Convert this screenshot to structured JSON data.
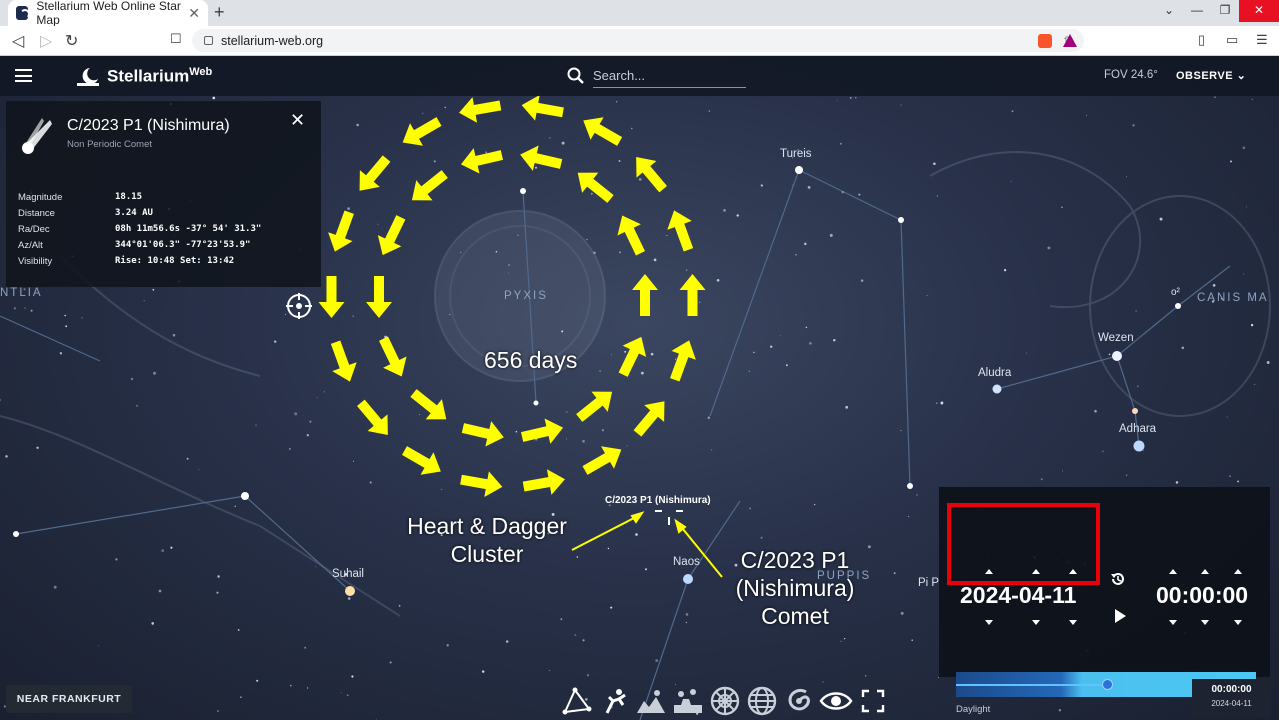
{
  "browser": {
    "tab_title": "Stellarium Web Online Star Map",
    "url": "stellarium-web.org",
    "new_tab": "+",
    "close_tab": "✕",
    "window_controls": [
      "⌄",
      "—",
      "❐",
      "✕"
    ]
  },
  "app": {
    "logo": "Stellarium",
    "logo_sup": "Web",
    "search_placeholder": "Search...",
    "fov": "FOV 24.6°",
    "observe": "OBSERVE ⌄"
  },
  "info_panel": {
    "title": "C/2023 P1 (Nishimura)",
    "subtitle": "Non Periodic Comet",
    "close": "✕",
    "rows": [
      {
        "label": "Magnitude",
        "value": "18.15"
      },
      {
        "label": "Distance",
        "value": "3.24 AU"
      },
      {
        "label": "Ra/Dec",
        "value": "08h 11m56.6s  -37° 54' 31.3\""
      },
      {
        "label": "Az/Alt",
        "value": "344°01'06.3\"  -77°23'53.9\""
      },
      {
        "label": "Visibility",
        "value": "Rise: 10:48   Set: 13:42"
      }
    ]
  },
  "sky_labels": {
    "stars": [
      "Tureis",
      "Wezen",
      "Aludra",
      "Adhara",
      "Suhail",
      "Naos",
      "Pi P",
      "o²"
    ],
    "constellations": [
      "PYXIS",
      "PUPPIS",
      "CANIS MA",
      "NTLIA"
    ],
    "comet_label": "C/2023 P1 (Nishimura)"
  },
  "annotations": {
    "days": "656 days",
    "heart_dagger": [
      "Heart & Dagger",
      "Cluster"
    ],
    "comet": [
      "C/2023 P1",
      "(Nishimura)",
      "Comet"
    ]
  },
  "time_panel": {
    "date": "2024-04-11",
    "time": "00:00:00",
    "daylight": "Daylight"
  },
  "location": "NEAR FRANKFURT",
  "mini_clock": {
    "time": "00:00:00",
    "date": "2024-04-11"
  },
  "toolbar_icons": [
    "constellation-lines-icon",
    "constellation-art-icon",
    "landscape-icon",
    "atmosphere-icon",
    "azimuthal-grid-icon",
    "equatorial-grid-icon",
    "deep-sky-icon",
    "night-mode-icon",
    "fullscreen-icon"
  ],
  "colors": {
    "annotation_arrows": "#ffff00",
    "date_highlight": "#e8000b",
    "slider": "#4bc9f3"
  }
}
